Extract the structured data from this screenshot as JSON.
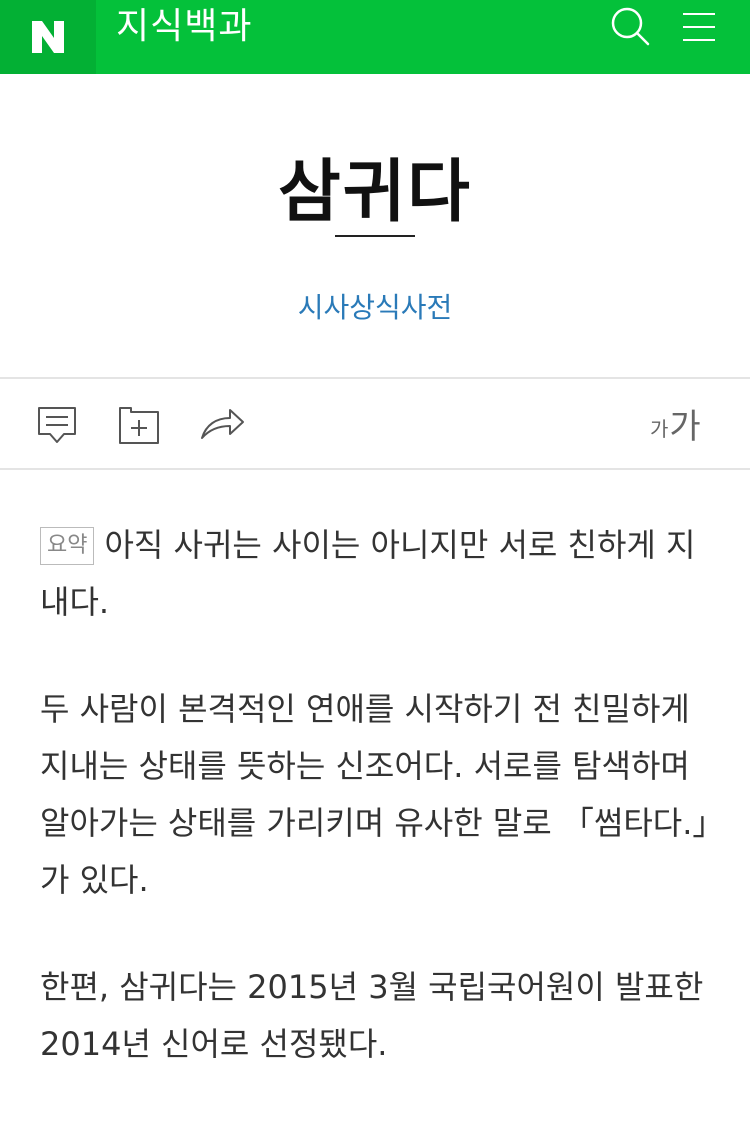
{
  "header": {
    "logo": "N",
    "brand": "지식백과",
    "search_icon": "search-icon",
    "menu_icon": "menu-icon",
    "colors": {
      "brand_green": "#04c13a",
      "logo_bg": "#03b034"
    }
  },
  "article": {
    "title": "삼귀다",
    "source": "시사상식사전",
    "source_color": "#2a7ab8"
  },
  "toolbar": {
    "comment_icon": "comment-icon",
    "folder_add_icon": "folder-add-icon",
    "share_icon": "share-icon",
    "font_small": "가",
    "font_large": "가"
  },
  "content": {
    "summary_tag": "요약",
    "summary": "아직 사귀는 사이는 아니지만 서로 친하게 지내다.",
    "paragraphs": [
      "두 사람이 본격적인 연애를 시작하기 전 친밀하게 지내는 상태를 뜻하는 신조어다. 서로를 탐색하며 알아가는 상태를 가리키며 유사한 말로 「썸타다.」가 있다.",
      "한편, 삼귀다는 2015년 3월 국립국어원이 발표한 2014년 신어로 선정됐다."
    ]
  }
}
